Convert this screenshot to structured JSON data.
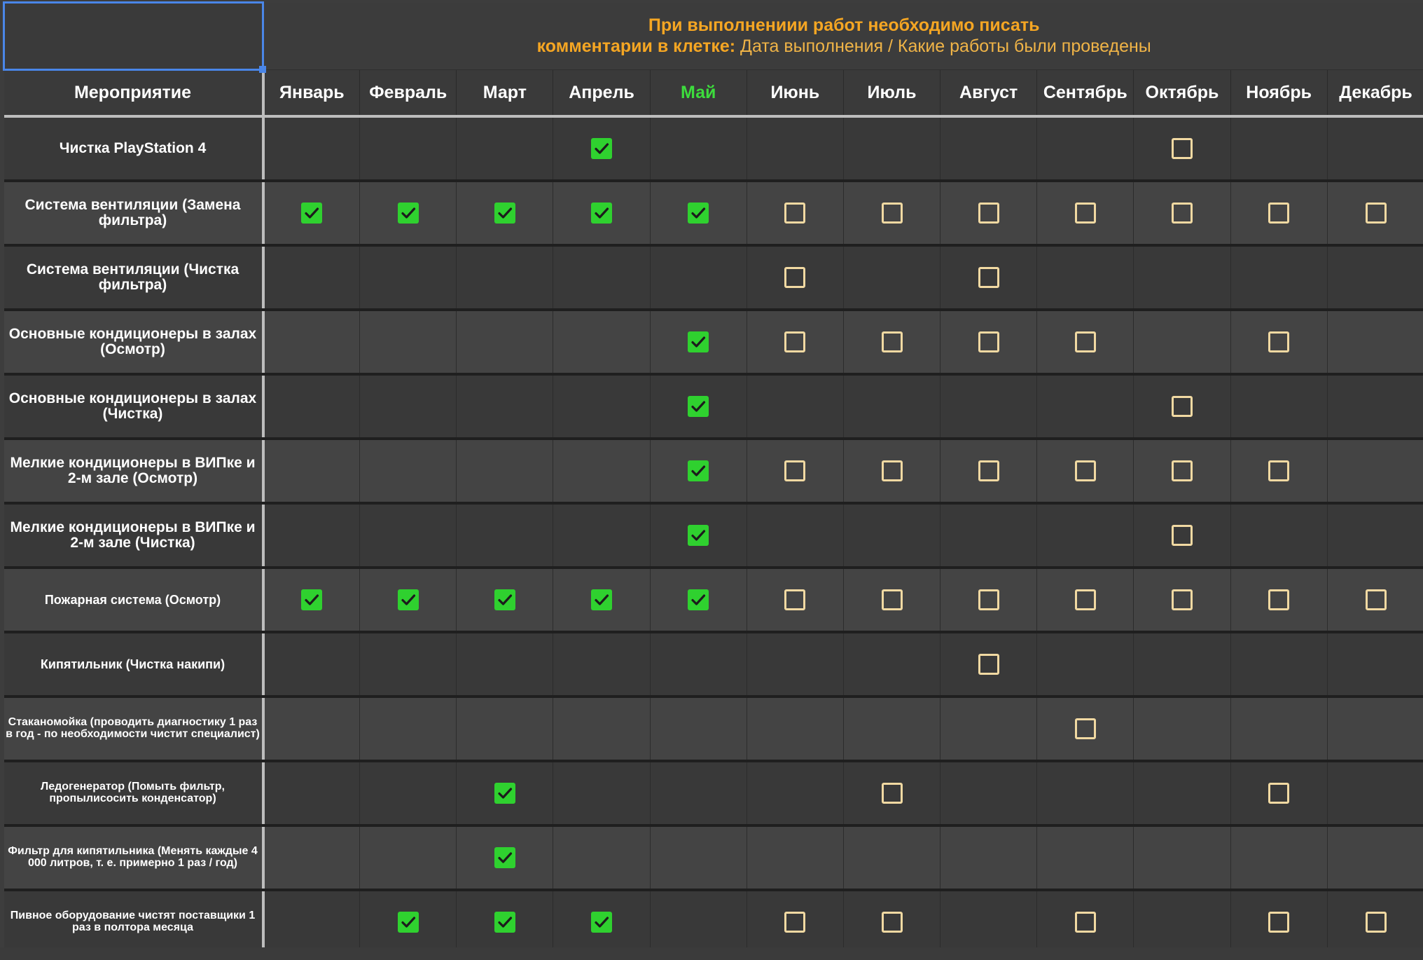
{
  "note": {
    "line1": "При выполнениии работ необходимо писать",
    "line2_bold": "комментарии в клетке:",
    "line2_rest": " Дата выполнения / Какие работы были проведены"
  },
  "columns": {
    "task_header": "Мероприятие",
    "months": [
      "Январь",
      "Февраль",
      "Март",
      "Апрель",
      "Май",
      "Июнь",
      "Июль",
      "Август",
      "Сентябрь",
      "Октябрь",
      "Ноябрь",
      "Декабрь"
    ],
    "current_month": "Май"
  },
  "colors": {
    "done": "#2fd12f",
    "todo_border": "#f1d9a2",
    "note": "#f5a623",
    "current_month": "#3ddc3d",
    "selection": "#4a86e8"
  },
  "status_legend": {
    "done": "checked-checkbox",
    "todo": "empty-checkbox",
    "none": "blank"
  },
  "rows": [
    {
      "task": "Чистка PlayStation 4",
      "size": "l",
      "marks": [
        "",
        "",
        "",
        "done",
        "",
        "",
        "",
        "",
        "",
        "todo",
        "",
        ""
      ]
    },
    {
      "task": "Система вентиляции (Замена фильтра)",
      "size": "l",
      "marks": [
        "done",
        "done",
        "done",
        "done",
        "done",
        "todo",
        "todo",
        "todo",
        "todo",
        "todo",
        "todo",
        "todo"
      ]
    },
    {
      "task": "Система вентиляции (Чистка фильтра)",
      "size": "l",
      "marks": [
        "",
        "",
        "",
        "",
        "",
        "todo",
        "",
        "todo",
        "",
        "",
        "",
        ""
      ]
    },
    {
      "task": "Основные кондиционеры в залах (Осмотр)",
      "size": "l",
      "marks": [
        "",
        "",
        "",
        "",
        "done",
        "todo",
        "todo",
        "todo",
        "todo",
        "",
        "todo",
        ""
      ]
    },
    {
      "task": "Основные кондиционеры в залах (Чистка)",
      "size": "l",
      "marks": [
        "",
        "",
        "",
        "",
        "done",
        "",
        "",
        "",
        "",
        "todo",
        "",
        ""
      ]
    },
    {
      "task": "Мелкие кондиционеры в ВИПке и 2-м зале (Осмотр)",
      "size": "l",
      "marks": [
        "",
        "",
        "",
        "",
        "done",
        "todo",
        "todo",
        "todo",
        "todo",
        "todo",
        "todo",
        ""
      ]
    },
    {
      "task": "Мелкие кондиционеры в ВИПке и 2-м зале (Чистка)",
      "size": "l",
      "marks": [
        "",
        "",
        "",
        "",
        "done",
        "",
        "",
        "",
        "",
        "todo",
        "",
        ""
      ]
    },
    {
      "task": "Пожарная система (Осмотр)",
      "size": "m",
      "marks": [
        "done",
        "done",
        "done",
        "done",
        "done",
        "todo",
        "todo",
        "todo",
        "todo",
        "todo",
        "todo",
        "todo"
      ]
    },
    {
      "task": "Кипятильник (Чистка накипи)",
      "size": "m",
      "marks": [
        "",
        "",
        "",
        "",
        "",
        "",
        "",
        "todo",
        "",
        "",
        "",
        ""
      ]
    },
    {
      "task": "Стаканомойка (проводить диагностику 1 раз в год - по необходимости чистит специалист)",
      "size": "s",
      "marks": [
        "",
        "",
        "",
        "",
        "",
        "",
        "",
        "",
        "todo",
        "",
        "",
        ""
      ]
    },
    {
      "task": "Ледогенератор (Помыть фильтр, пропылисосить конденсатор)",
      "size": "s",
      "marks": [
        "",
        "",
        "done",
        "",
        "",
        "",
        "todo",
        "",
        "",
        "",
        "todo",
        ""
      ]
    },
    {
      "task": "Фильтр для кипятильника (Менять каждые 4 000 литров, т. е. примерно 1 раз / год)",
      "size": "s",
      "marks": [
        "",
        "",
        "done",
        "",
        "",
        "",
        "",
        "",
        "",
        "",
        "",
        ""
      ]
    },
    {
      "task": "Пивное оборудование чистят поставщики 1 раз в полтора месяца",
      "size": "s",
      "marks": [
        "",
        "done",
        "done",
        "done",
        "",
        "todo",
        "todo",
        "",
        "todo",
        "",
        "todo",
        "todo"
      ]
    }
  ]
}
